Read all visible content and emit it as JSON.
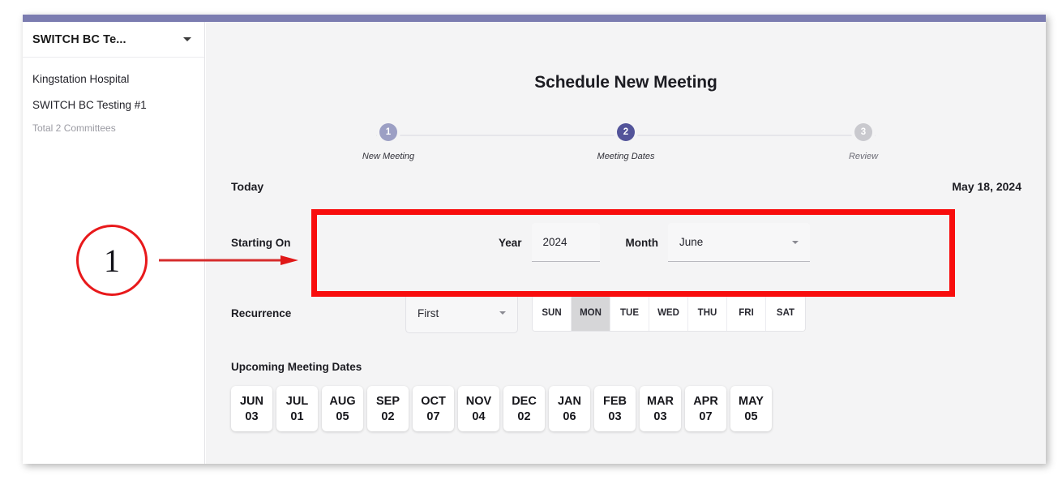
{
  "sidebar": {
    "selector": {
      "label": "SWITCH BC Te...",
      "caret_icon": "chevron-down-icon"
    },
    "items": [
      {
        "label": "Kingstation Hospital"
      },
      {
        "label": "SWITCH BC Testing #1"
      }
    ],
    "total_text": "Total 2 Committees"
  },
  "main": {
    "title": "Schedule New Meeting",
    "stepper": [
      {
        "number": "1",
        "label": "New Meeting",
        "state": "done"
      },
      {
        "number": "2",
        "label": "Meeting Dates",
        "state": "active"
      },
      {
        "number": "3",
        "label": "Review",
        "state": "todo"
      }
    ],
    "today": {
      "label": "Today",
      "value": "May 18, 2024"
    },
    "starting_on": {
      "label": "Starting On",
      "year_label": "Year",
      "year_value": "2024",
      "month_label": "Month",
      "month_value": "June",
      "month_caret_icon": "chevron-down-icon"
    },
    "recurrence": {
      "label": "Recurrence",
      "ordinal_value": "First",
      "ordinal_caret_icon": "chevron-down-icon",
      "days": [
        {
          "label": "SUN",
          "selected": false
        },
        {
          "label": "MON",
          "selected": true
        },
        {
          "label": "TUE",
          "selected": false
        },
        {
          "label": "WED",
          "selected": false
        },
        {
          "label": "THU",
          "selected": false
        },
        {
          "label": "FRI",
          "selected": false
        },
        {
          "label": "SAT",
          "selected": false
        }
      ]
    },
    "upcoming": {
      "title": "Upcoming Meeting Dates",
      "dates": [
        {
          "month": "JUN",
          "day": "03"
        },
        {
          "month": "JUL",
          "day": "01"
        },
        {
          "month": "AUG",
          "day": "05"
        },
        {
          "month": "SEP",
          "day": "02"
        },
        {
          "month": "OCT",
          "day": "07"
        },
        {
          "month": "NOV",
          "day": "04"
        },
        {
          "month": "DEC",
          "day": "02"
        },
        {
          "month": "JAN",
          "day": "06"
        },
        {
          "month": "FEB",
          "day": "03"
        },
        {
          "month": "MAR",
          "day": "03"
        },
        {
          "month": "APR",
          "day": "07"
        },
        {
          "month": "MAY",
          "day": "05"
        }
      ]
    }
  },
  "annotation": {
    "callout_number": "1",
    "arrow_icon": "arrow-right-icon",
    "highlight_color": "#f80d0d",
    "callout_color": "#e8191b"
  },
  "colors": {
    "top_bar": "#7b7cb0",
    "step_active": "#53549a",
    "step_done": "#9c9fc4",
    "step_todo": "#c9c9ce",
    "main_bg": "#f4f4f5",
    "day_selected_bg": "#d6d6d8"
  }
}
